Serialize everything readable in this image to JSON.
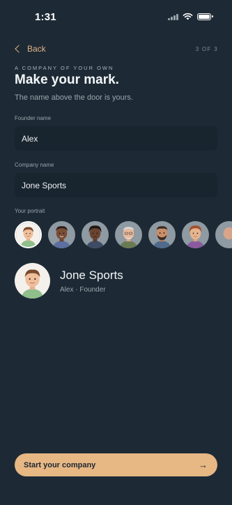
{
  "status_bar": {
    "time": "1:31",
    "icons": [
      "cellular-icon",
      "wifi-icon",
      "battery-icon"
    ]
  },
  "nav": {
    "back_label": "Back",
    "step_text": "3 OF 3"
  },
  "header": {
    "eyebrow": "A COMPANY OF YOUR OWN",
    "title": "Make your mark.",
    "subtitle": "The name above the door is yours."
  },
  "form": {
    "founder_label": "Founder name",
    "founder_value": "Alex",
    "company_label": "Company name",
    "company_value": "Jone Sports",
    "portrait_label": "Your portrait"
  },
  "portraits": {
    "selected_index": 0
  },
  "preview": {
    "company_name": "Jone Sports",
    "meta": "Alex · Founder"
  },
  "cta": {
    "label": "Start your company",
    "icon": "arrow-right-icon"
  },
  "colors": {
    "background": "#1d2a35",
    "field_background": "#18242e",
    "accent": "#e7b784",
    "back_link": "#e0b483"
  }
}
